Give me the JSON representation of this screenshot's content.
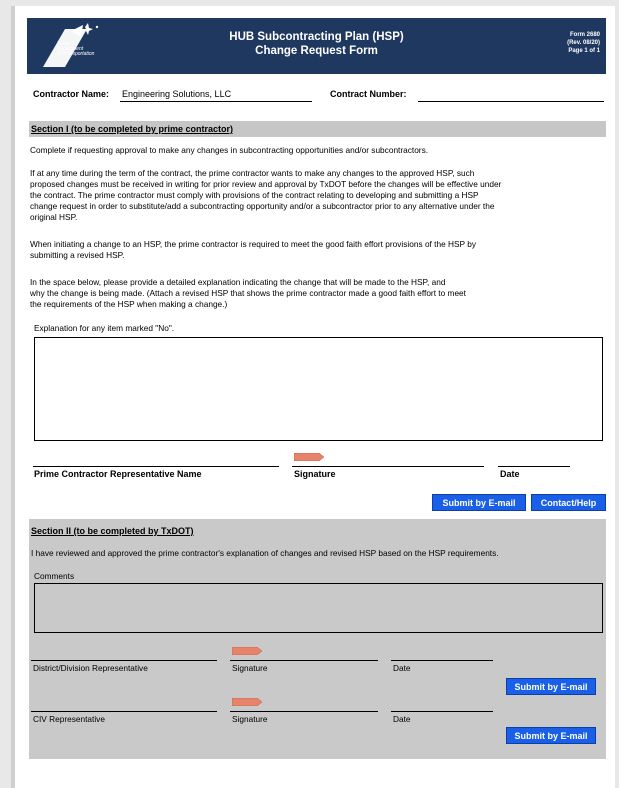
{
  "header": {
    "logo_text": [
      "Texas",
      "Department",
      "of Transportation"
    ],
    "title_line1": "HUB Subcontracting Plan (HSP)",
    "title_line2": "Change Request Form",
    "form_number": "Form 2680",
    "revision": "(Rev. 08/20)",
    "page": "Page 1 of 1"
  },
  "contractor": {
    "name_label": "Contractor Name:",
    "name_value": "Engineering Solutions, LLC",
    "number_label": "Contract Number:",
    "number_value": ""
  },
  "section1": {
    "heading": "Section I (to be completed by prime contractor)",
    "p1": "Complete if requesting approval to make any changes in subcontracting opportunities and/or subcontractors.",
    "p2_lines": [
      "If at any time during the term of the contract, the prime contractor wants to make any changes to the approved HSP, such",
      "proposed changes must be received in writing for prior review and approval by TxDOT before the changes will be effective under",
      "the contract. The prime contractor must comply with provisions of the contract relating to developing and submitting a HSP",
      "change request in order to substitute/add a subcontracting opportunity and/or a subcontractor prior to any alternative under the",
      "original HSP."
    ],
    "p3_lines": [
      "When initiating a change to an HSP, the prime contractor is required to meet the good faith effort provisions of the HSP by",
      "submitting a revised HSP."
    ],
    "p4_lines": [
      "In the space below, please provide a detailed explanation indicating the change that will be made to the HSP, and",
      "why the change is being made. (Attach a revised HSP that shows the prime contractor made a good faith effort to meet",
      "the requirements of the HSP when making a change.)"
    ],
    "explanation_label": "Explanation for any item marked \"No\".",
    "explanation_value": "",
    "rep_name_label": "Prime Contractor Representative Name",
    "signature_label": "Signature",
    "date_label": "Date",
    "submit_label": "Submit by E-mail",
    "help_label": "Contact/Help"
  },
  "section2": {
    "heading": "Section II (to be completed by TxDOT)",
    "p1": "I have reviewed and approved the prime contractor's explanation of changes and revised HSP based on the HSP requirements.",
    "comments_label": "Comments",
    "district_label": "District/Division Representative",
    "signature_label": "Signature",
    "date_label": "Date",
    "civ_label": "CIV Representative",
    "submit_label": "Submit by E-mail"
  },
  "colors": {
    "header_bg": "#1f3860",
    "button_bg": "#1a5fe8",
    "section_bg": "#c6c6c6",
    "sign_tag": "#e8836b"
  }
}
